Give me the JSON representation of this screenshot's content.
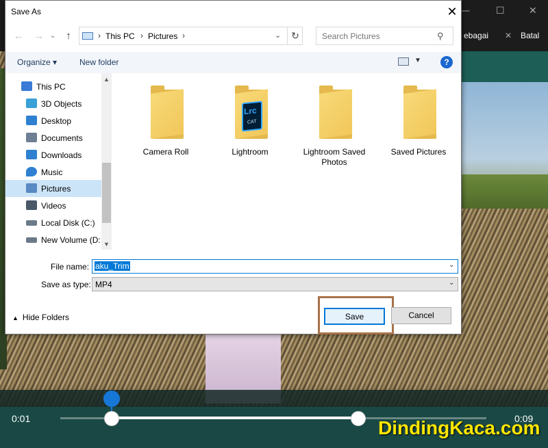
{
  "app": {
    "toolbar_text_1": "ebagai",
    "toolbar_text_2": "Batal",
    "time_start": "0:01",
    "time_end": "0:09",
    "watermark": "DindingKaca.com",
    "playhead_fraction": 0.12,
    "trim_start_fraction": 0.12,
    "trim_end_fraction": 0.7
  },
  "dialog": {
    "title": "Save As",
    "close": "✕",
    "nav": {
      "back": "←",
      "forward": "→",
      "up": "↑"
    },
    "breadcrumb": [
      "This PC",
      "Pictures"
    ],
    "breadcrumb_separator": "›",
    "search_placeholder": "Search Pictures",
    "commands": {
      "organize": "Organize ▾",
      "new_folder": "New folder",
      "help": "?"
    },
    "sidebar": [
      {
        "label": "This PC",
        "icon": "computer-icon",
        "color": "#3a7bd5",
        "root": true
      },
      {
        "label": "3D Objects",
        "icon": "cube-icon",
        "color": "#3aa0d8"
      },
      {
        "label": "Desktop",
        "icon": "desktop-icon",
        "color": "#2f80d1"
      },
      {
        "label": "Documents",
        "icon": "documents-icon",
        "color": "#6e7f93"
      },
      {
        "label": "Downloads",
        "icon": "download-icon",
        "color": "#2f80d1"
      },
      {
        "label": "Music",
        "icon": "music-icon",
        "color": "#2f80d1"
      },
      {
        "label": "Pictures",
        "icon": "pictures-icon",
        "color": "#5a8ac4",
        "selected": true
      },
      {
        "label": "Videos",
        "icon": "videos-icon",
        "color": "#4a5968"
      },
      {
        "label": "Local Disk (C:)",
        "icon": "drive-icon",
        "color": "#6b7a88"
      },
      {
        "label": "New Volume (D:",
        "icon": "drive-icon",
        "color": "#6b7a88"
      }
    ],
    "files": [
      {
        "name": "Camera Roll",
        "type": "folder"
      },
      {
        "name": "Lightroom",
        "type": "lightroom-folder",
        "badge_top": "Lrc",
        "badge_bottom": "CAT"
      },
      {
        "name": "Lightroom Saved Photos",
        "type": "folder"
      },
      {
        "name": "Saved Pictures",
        "type": "folder"
      }
    ],
    "file_name_label": "File name:",
    "file_name_value": "aku_Trim",
    "save_type_label": "Save as type:",
    "save_type_value": "MP4",
    "hide_folders": "Hide Folders",
    "save": "Save",
    "cancel": "Cancel"
  },
  "colors": {
    "accent": "#0078d7",
    "selection": "#cce4f7",
    "highlight_box": "#a8724a",
    "watermark": "#ffe600",
    "timeline": "#1a4945"
  }
}
